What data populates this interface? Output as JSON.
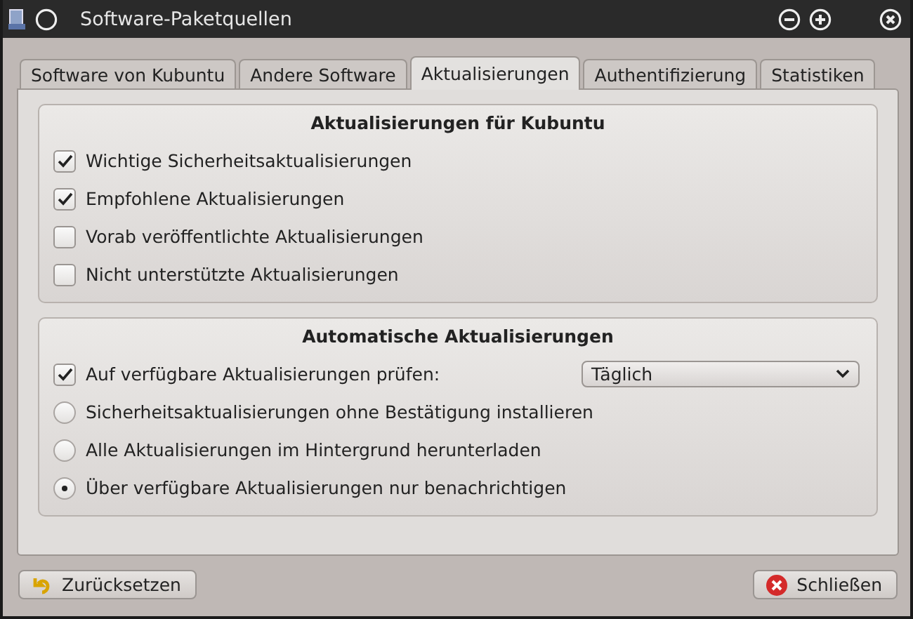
{
  "window": {
    "title": "Software-Paketquellen"
  },
  "tabs": [
    {
      "label": "Software von Kubuntu",
      "selected": false
    },
    {
      "label": "Andere Software",
      "selected": false
    },
    {
      "label": "Aktualisierungen",
      "selected": true
    },
    {
      "label": "Authentifizierung",
      "selected": false
    },
    {
      "label": "Statistiken",
      "selected": false
    }
  ],
  "groups": [
    {
      "title": "Aktualisierungen für Kubuntu",
      "items": [
        {
          "kind": "checkbox",
          "label": "Wichtige Sicherheitsaktualisierungen",
          "checked": true
        },
        {
          "kind": "checkbox",
          "label": "Empfohlene Aktualisierungen",
          "checked": true
        },
        {
          "kind": "checkbox",
          "label": "Vorab veröffentlichte Aktualisierungen",
          "checked": false
        },
        {
          "kind": "checkbox",
          "label": "Nicht unterstützte Aktualisierungen",
          "checked": false
        }
      ]
    },
    {
      "title": "Automatische Aktualisierungen",
      "items": [
        {
          "kind": "checkbox",
          "label": "Auf verfügbare Aktualisierungen prüfen:",
          "checked": true,
          "select": {
            "value": "Täglich"
          }
        },
        {
          "kind": "radio",
          "label": "Sicherheitsaktualisierungen ohne Bestätigung installieren",
          "selected": false
        },
        {
          "kind": "radio",
          "label": "Alle Aktualisierungen im Hintergrund herunterladen",
          "selected": false
        },
        {
          "kind": "radio",
          "label": "Über verfügbare Aktualisierungen nur benachrichtigen",
          "selected": true
        }
      ]
    }
  ],
  "buttons": [
    {
      "kind": "reset",
      "label": "Zurücksetzen"
    },
    {
      "kind": "close",
      "label": "Schließen"
    }
  ]
}
